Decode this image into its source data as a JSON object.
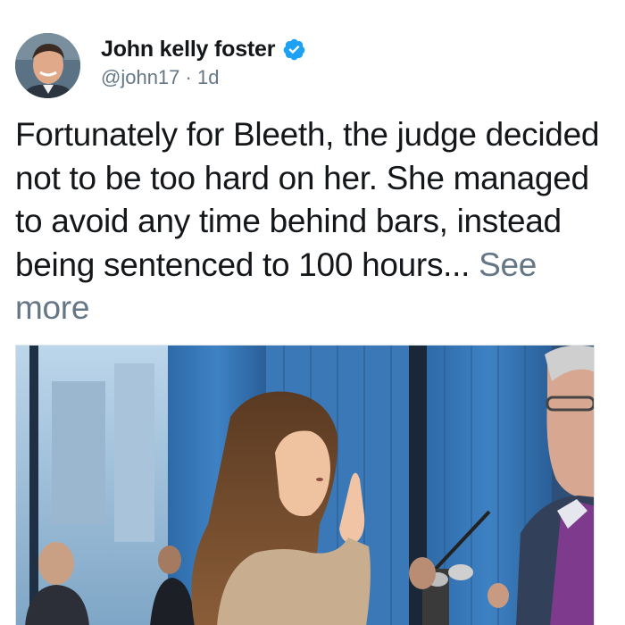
{
  "tweet": {
    "author": {
      "display_name": "John kelly foster",
      "handle": "@john17",
      "verified": true,
      "verified_icon": "verified-badge-icon",
      "verified_color": "#1da1f2"
    },
    "separator": "·",
    "timestamp": "1d",
    "text": "Fortunately for Bleeth, the judge decided not to be too hard on her. She managed to avoid any time behind bars, instead being sentenced to 100 hours...",
    "see_more_label": "See more",
    "colors": {
      "text": "#14171a",
      "secondary": "#657786"
    }
  }
}
